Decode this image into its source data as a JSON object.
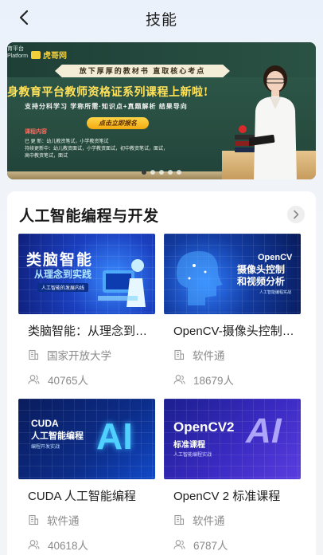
{
  "header": {
    "title": "技能"
  },
  "banner": {
    "logo_line1": "育平台",
    "logo_line2": "Platform",
    "logo_brand": "虎哥网",
    "ribbon": "放下厚厚的教材书 直取核心考点",
    "headline": "身教育平台教师资格证系列课程上新啦!",
    "subline": "支持分科学习   学称所需·知识点+真题解析   结果导向",
    "cta": "点击立即报名",
    "content_heading": "课程内容",
    "content_lines": [
      "已  更  新：幼儿教资笔试，小学教资笔试",
      "持续更新中：幼儿教资面试，小学教资面试，初中教资笔试，面试，",
      "            高中教资笔试，面试"
    ],
    "carousel_count": 5,
    "carousel_active": 0
  },
  "section": {
    "title": "人工智能编程与开发",
    "courses": [
      {
        "title": "类脑智能：从理念到实践",
        "provider": "国家开放大学",
        "learners": "40765人",
        "thumb_title": "类脑智能",
        "thumb_sub": "从理念到实践",
        "thumb_tag": "人工智能的发展内线"
      },
      {
        "title": "OpenCV-摄像头控制和视频分析",
        "provider": "软件通",
        "learners": "18679人",
        "thumb_title": "OpenCV",
        "thumb_sub1": "摄像头控制",
        "thumb_sub2": "和视频分析",
        "thumb_tag": "人工智能编程实战"
      },
      {
        "title": "CUDA 人工智能编程",
        "provider": "软件通",
        "learners": "40618人",
        "thumb_title": "CUDA",
        "thumb_sub": "人工智能编程",
        "thumb_tag": "编程开发实战",
        "thumb_big": "AI"
      },
      {
        "title": "OpenCV 2 标准课程",
        "provider": "软件通",
        "learners": "6787人",
        "thumb_title": "OpenCV2",
        "thumb_sub": "标准课程",
        "thumb_tag": "人工智能编程实战",
        "thumb_big": "AI"
      }
    ]
  },
  "colors": {
    "page_bg": "#f3f4f6",
    "card_bg": "#ffffff",
    "meta_text": "#8a8a8a",
    "banner_headline": "#ffe15a"
  }
}
